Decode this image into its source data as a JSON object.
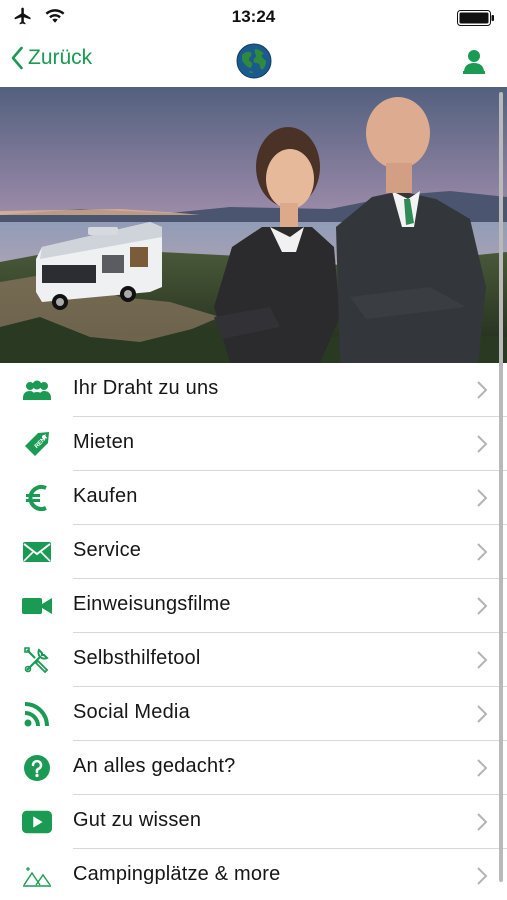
{
  "status": {
    "time": "13:24"
  },
  "nav": {
    "back_label": "Zurück",
    "globe_icon": "globe-icon",
    "profile_icon": "user-icon"
  },
  "colors": {
    "accent": "#1a9a52",
    "chevron": "#b4b4b4",
    "divider": "#d8d8d8"
  },
  "menu": [
    {
      "label": "Ihr Draht zu uns",
      "icon": "group-icon"
    },
    {
      "label": "Mieten",
      "icon": "rent-tag-icon"
    },
    {
      "label": "Kaufen",
      "icon": "euro-icon"
    },
    {
      "label": "Service",
      "icon": "envelope-icon"
    },
    {
      "label": "Einweisungsfilme",
      "icon": "video-camera-icon"
    },
    {
      "label": "Selbsthilfetool",
      "icon": "tools-icon"
    },
    {
      "label": "Social Media",
      "icon": "rss-icon"
    },
    {
      "label": "An alles gedacht?",
      "icon": "question-icon"
    },
    {
      "label": "Gut zu wissen",
      "icon": "play-icon"
    },
    {
      "label": "Campingplätze & more",
      "icon": "campsite-icon"
    }
  ]
}
